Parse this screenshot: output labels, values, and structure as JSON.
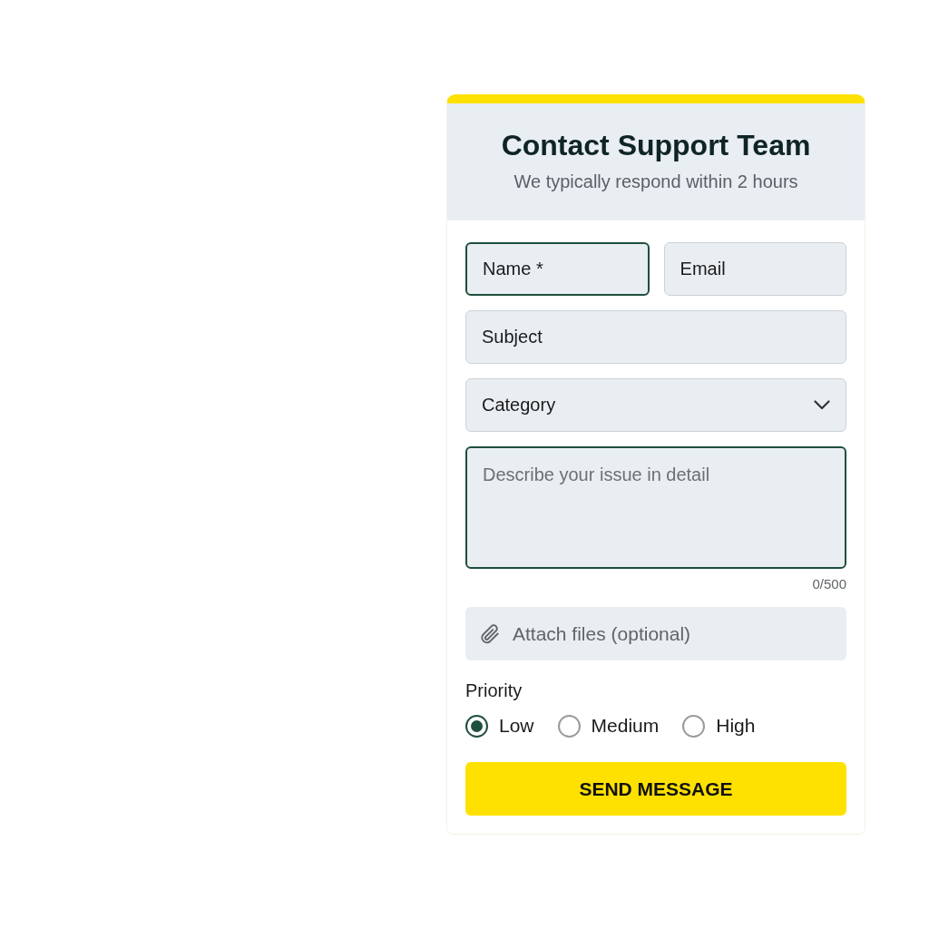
{
  "header": {
    "title": "Contact Support Team",
    "subtitle": "We typically respond within 2 hours"
  },
  "field_rows": [
    [
      {
        "kind": "text",
        "placeholder": "Name *",
        "focused": true
      },
      {
        "kind": "text",
        "placeholder": "Email",
        "focused": false
      }
    ],
    [
      {
        "kind": "text",
        "placeholder": "Subject",
        "focused": false
      }
    ],
    [
      {
        "kind": "select",
        "value": "Category",
        "focused": false
      }
    ],
    [
      {
        "kind": "textarea",
        "placeholder": "Describe your issue in detail",
        "focused": true
      }
    ]
  ],
  "char_count": "0/500",
  "attach": {
    "label": "Attach files (optional)"
  },
  "priority": {
    "label": "Priority",
    "options": [
      {
        "label": "Low",
        "selected": true
      },
      {
        "label": "Medium",
        "selected": false
      },
      {
        "label": "High",
        "selected": false
      }
    ]
  },
  "submit": {
    "label": "SEND MESSAGE"
  }
}
